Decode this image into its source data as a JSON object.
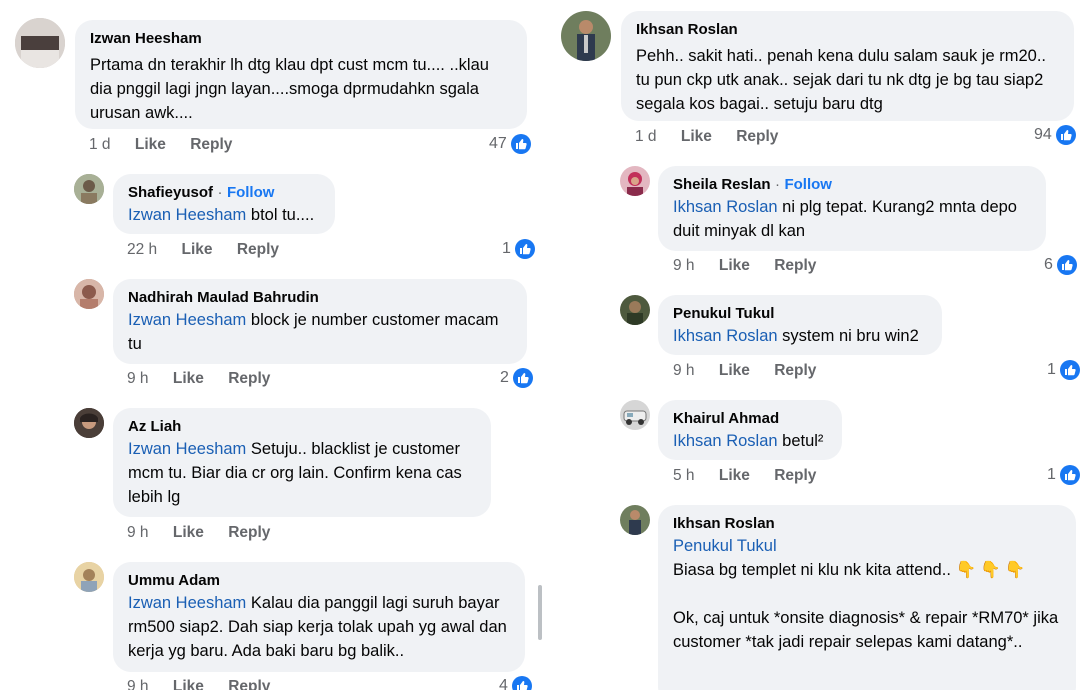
{
  "left": {
    "main": {
      "author": "Izwan Heesham",
      "text": "Prtama dn terakhir lh dtg klau dpt cust mcm tu.... ..klau dia pnggil lagi jngn layan....smoga dprmudahkn sgala urusan awk....",
      "time": "1 d",
      "like": "Like",
      "reply": "Reply",
      "count": "47"
    },
    "replies": [
      {
        "author": "Shafieyusof",
        "dot": "·",
        "follow": "Follow",
        "mention": "Izwan Heesham",
        "text": " btol tu....",
        "time": "22 h",
        "like": "Like",
        "reply": "Reply",
        "count": "1"
      },
      {
        "author": "Nadhirah Maulad Bahrudin",
        "mention": "Izwan Heesham",
        "text": " block je number customer macam tu",
        "time": "9 h",
        "like": "Like",
        "reply": "Reply",
        "count": "2"
      },
      {
        "author": "Az Liah",
        "mention": "Izwan Heesham",
        "text": " Setuju.. blacklist je customer mcm tu. Biar dia cr org lain. Confirm kena cas lebih lg",
        "time": "9 h",
        "like": "Like",
        "reply": "Reply"
      },
      {
        "author": "Ummu Adam",
        "mention": "Izwan Heesham",
        "text": " Kalau dia panggil lagi suruh bayar rm500 siap2. Dah siap kerja tolak upah yg awal dan kerja yg baru. Ada baki baru bg balik..",
        "time": "9 h",
        "like": "Like",
        "reply": "Reply",
        "count": "4"
      }
    ]
  },
  "right": {
    "main": {
      "author": "Ikhsan Roslan",
      "text": "Pehh.. sakit hati.. penah kena dulu salam sauk je rm20.. tu pun ckp utk anak.. sejak dari tu nk dtg je bg tau siap2 segala kos bagai.. setuju baru dtg",
      "time": "1 d",
      "like": "Like",
      "reply": "Reply",
      "count": "94"
    },
    "replies": [
      {
        "author": "Sheila Reslan",
        "dot": "·",
        "follow": "Follow",
        "mention": "Ikhsan Roslan",
        "text": " ni plg tepat. Kurang2 mnta depo duit minyak dl kan",
        "time": "9 h",
        "like": "Like",
        "reply": "Reply",
        "count": "6"
      },
      {
        "author": "Penukul Tukul",
        "mention": "Ikhsan Roslan",
        "text": " system ni bru win2",
        "time": "9 h",
        "like": "Like",
        "reply": "Reply",
        "count": "1"
      },
      {
        "author": "Khairul Ahmad",
        "mention": "Ikhsan Roslan",
        "text": " betul²",
        "time": "5 h",
        "like": "Like",
        "reply": "Reply",
        "count": "1"
      },
      {
        "author": "Ikhsan Roslan",
        "mention": "Penukul Tukul",
        "line1": "Biasa bg templet ni klu nk kita attend..",
        "emoji": "👇👇👇",
        "line2": "Ok, caj untuk *onsite diagnosis* & repair *RM70* jika customer *tak jadi repair selepas kami datang*.."
      }
    ]
  },
  "colors": {
    "accent": "#1877f2",
    "bubble": "#f0f2f5",
    "meta": "#65676b"
  },
  "icons": {
    "reaction": "like-thumb-icon"
  }
}
